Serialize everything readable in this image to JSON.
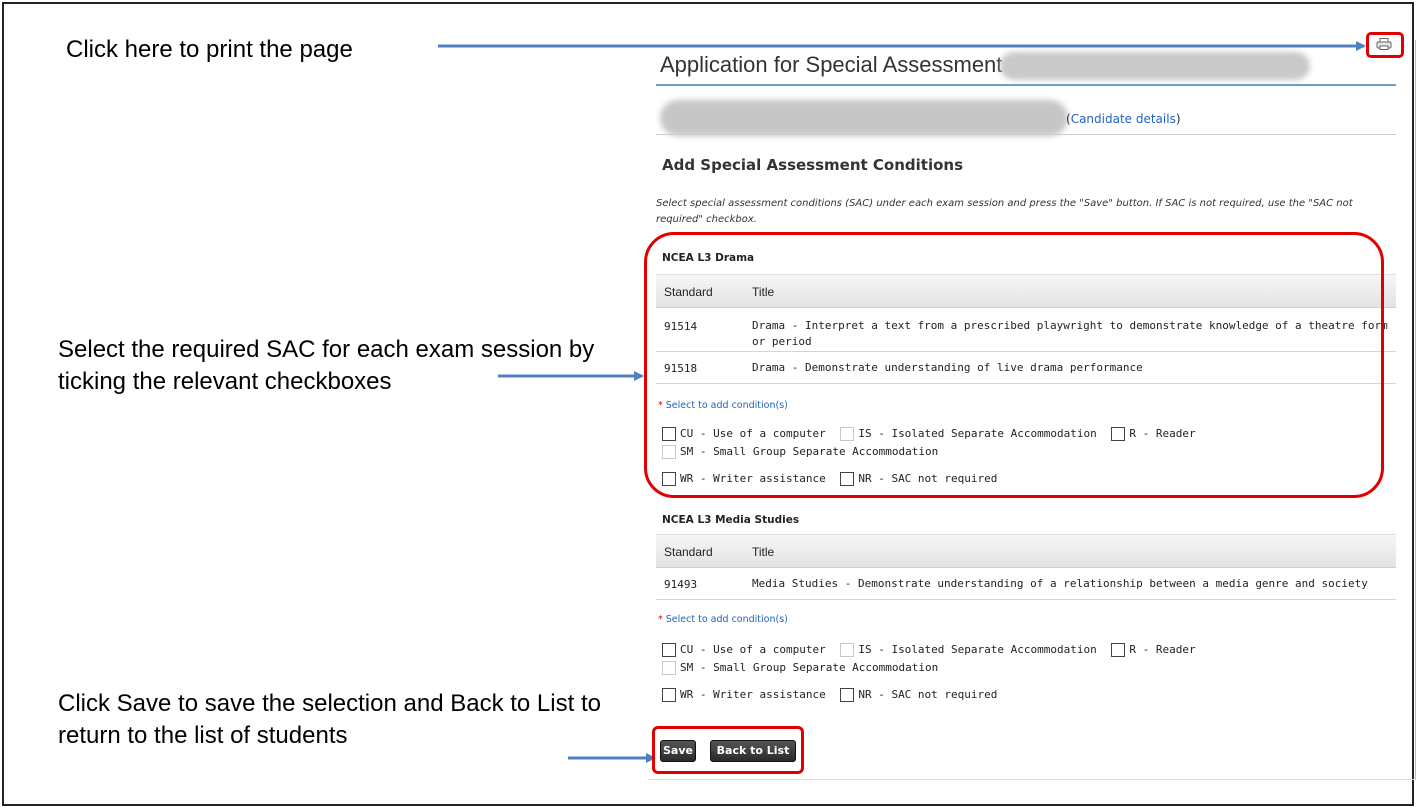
{
  "callouts": {
    "print": "Click here to print the page",
    "select": "Select the required SAC for each exam session by ticking the relevant checkboxes",
    "save": "Click Save to save the selection and Back to List to return to the list of students"
  },
  "header": {
    "title": "Application for Special Assessment -",
    "candidate_link": "Candidate details"
  },
  "section": {
    "heading": "Add Special Assessment Conditions",
    "instructions": "Select special assessment conditions (SAC) under each exam session and press the \"Save\" button. If SAC is not required, use the \"SAC not required\" checkbox."
  },
  "table_headers": {
    "standard": "Standard",
    "title": "Title"
  },
  "sessions": [
    {
      "title": "NCEA L3 Drama",
      "standards": [
        {
          "code": "91514",
          "title": "Drama - Interpret a text from a prescribed playwright to demonstrate knowledge of a theatre form or period"
        },
        {
          "code": "91518",
          "title": "Drama - Demonstrate understanding of live drama performance"
        }
      ]
    },
    {
      "title": "NCEA L3 Media Studies",
      "standards": [
        {
          "code": "91493",
          "title": "Media Studies - Demonstrate understanding of a relationship between a media genre and society"
        }
      ]
    }
  ],
  "select_hint": "Select to add condition(s)",
  "conditions": {
    "cu": "CU - Use of a computer",
    "is": "IS - Isolated Separate Accommodation",
    "r": "R - Reader",
    "sm": "SM - Small Group Separate Accommodation",
    "wr": "WR - Writer assistance",
    "nr": "NR - SAC not required"
  },
  "buttons": {
    "save": "Save",
    "back": "Back to List"
  },
  "colors": {
    "highlight": "#e00000",
    "arrow": "#4f81bd",
    "link": "#1f63c6"
  }
}
